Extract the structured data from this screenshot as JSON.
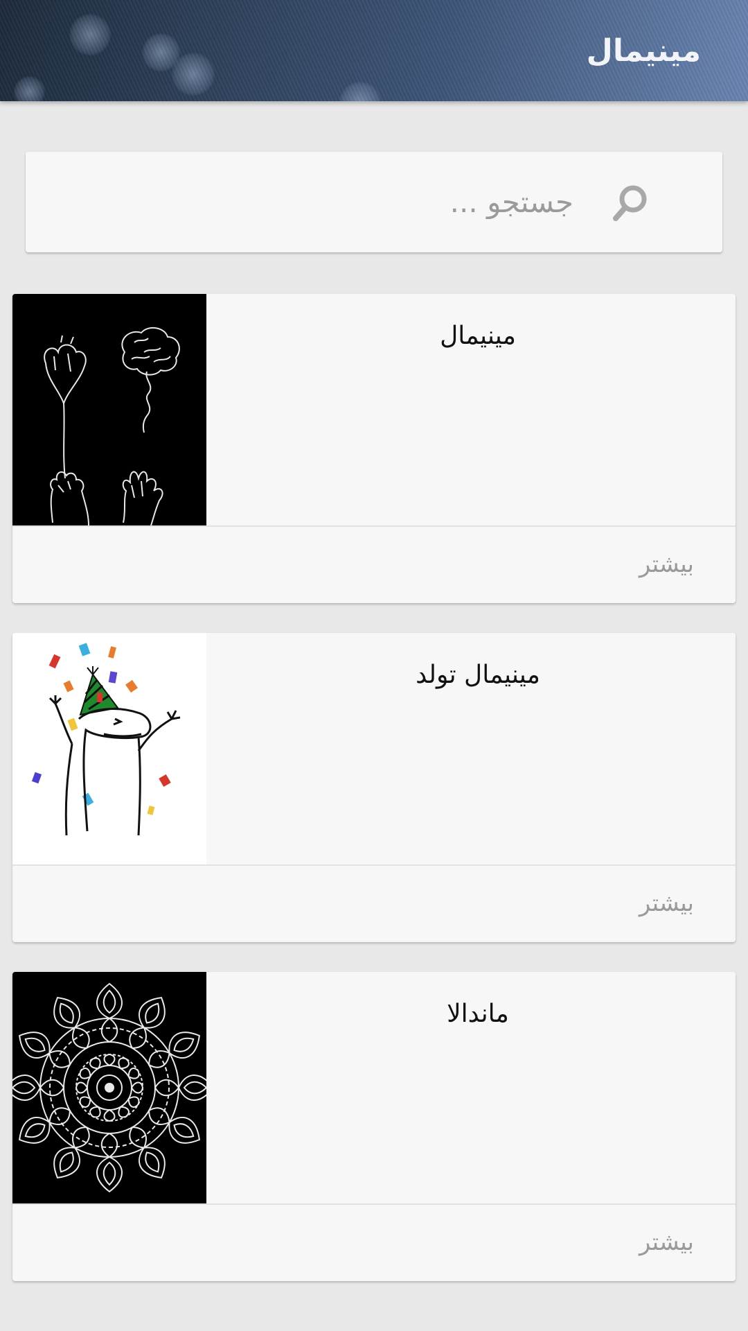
{
  "header": {
    "title": "مینیمال"
  },
  "search": {
    "placeholder": "جستجو ..."
  },
  "cards": [
    {
      "title": "مینیمال",
      "more_label": "بیشتر",
      "image": "heart-and-brain-balloons"
    },
    {
      "title": "مینیمال تولد",
      "more_label": "بیشتر",
      "image": "birthday-party-character"
    },
    {
      "title": "ماندالا",
      "more_label": "بیشتر",
      "image": "mandala"
    }
  ],
  "colors": {
    "header_gradient_start": "#1e2b3d",
    "header_gradient_end": "#6a86b3",
    "background": "#e8e8e8",
    "card": "#f7f7f7",
    "muted_text": "#9a9a9a"
  }
}
